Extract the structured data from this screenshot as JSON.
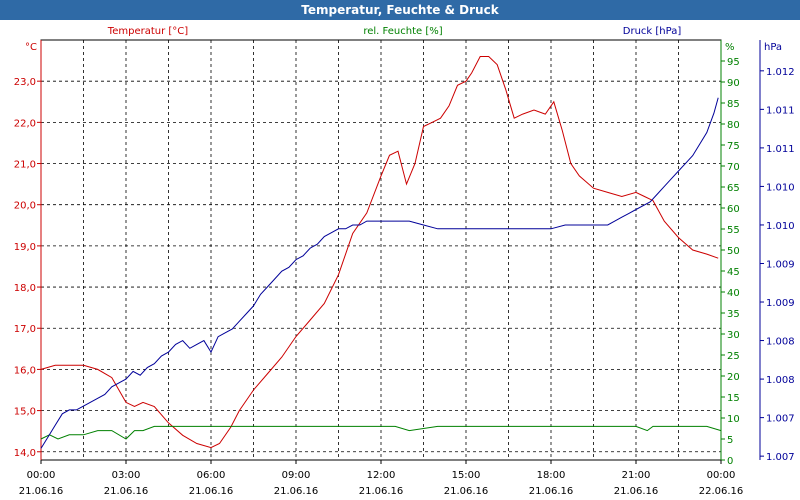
{
  "window": {
    "title": "Temperatur, Feuchte & Druck"
  },
  "colors": {
    "temperature": "#cc0000",
    "humidity": "#008000",
    "pressure": "#000099",
    "titlebar": "#2f6aa6"
  },
  "chart_data": {
    "type": "line",
    "grid": true,
    "x": {
      "tick_times": [
        "00:00",
        "03:00",
        "06:00",
        "09:00",
        "12:00",
        "15:00",
        "18:00",
        "21:00",
        "00:00"
      ],
      "tick_dates": [
        "21.06.16",
        "21.06.16",
        "21.06.16",
        "21.06.16",
        "21.06.16",
        "21.06.16",
        "21.06.16",
        "21.06.16",
        "22.06.16"
      ],
      "range_hours": [
        0,
        24
      ]
    },
    "axes": {
      "temperature": {
        "unit": "°C",
        "ylim": [
          13.8,
          24.0
        ],
        "ticks": [
          "14,0",
          "15,0",
          "16,0",
          "17,0",
          "18,0",
          "19,0",
          "20,0",
          "21,0",
          "22,0",
          "23,0"
        ]
      },
      "humidity": {
        "unit": "%",
        "ylim": [
          0,
          100
        ],
        "ticks": [
          "0",
          "5",
          "10",
          "15",
          "20",
          "25",
          "30",
          "35",
          "40",
          "45",
          "50",
          "55",
          "60",
          "65",
          "70",
          "75",
          "80",
          "85",
          "90",
          "95"
        ]
      },
      "pressure": {
        "unit": "hPa",
        "ylim": [
          1006.95,
          1012.4
        ],
        "ticks": [
          "1.007",
          "1.007",
          "1.008",
          "1.008",
          "1.009",
          "1.009",
          "1.010",
          "1.010",
          "1.011",
          "1.011",
          "1.012"
        ]
      }
    },
    "series": [
      {
        "name": "Temperatur [°C]",
        "axis": "temperature",
        "x": [
          0,
          0.5,
          1,
          1.5,
          2,
          2.5,
          3,
          3.3,
          3.6,
          4,
          4.5,
          5,
          5.5,
          6,
          6.3,
          6.7,
          7,
          7.5,
          8,
          8.5,
          9,
          9.5,
          10,
          10.5,
          11,
          11.5,
          12,
          12.3,
          12.6,
          12.9,
          13.2,
          13.5,
          13.8,
          14.1,
          14.4,
          14.7,
          15,
          15.2,
          15.5,
          15.8,
          16.1,
          16.4,
          16.7,
          17,
          17.4,
          17.8,
          18.1,
          18.4,
          18.7,
          19,
          19.5,
          20,
          20.5,
          21,
          21.3,
          21.6,
          22,
          22.5,
          23,
          23.5,
          23.9
        ],
        "values": [
          16.0,
          16.1,
          16.1,
          16.1,
          16.0,
          15.8,
          15.2,
          15.1,
          15.2,
          15.1,
          14.7,
          14.4,
          14.2,
          14.1,
          14.2,
          14.6,
          15.0,
          15.5,
          15.9,
          16.3,
          16.8,
          17.2,
          17.6,
          18.3,
          19.3,
          19.8,
          20.7,
          21.2,
          21.3,
          20.5,
          21.0,
          21.9,
          22.0,
          22.1,
          22.4,
          22.9,
          23.0,
          23.2,
          23.6,
          23.6,
          23.4,
          22.8,
          22.1,
          22.2,
          22.3,
          22.2,
          22.5,
          21.8,
          21.0,
          20.7,
          20.4,
          20.3,
          20.2,
          20.3,
          20.2,
          20.1,
          19.6,
          19.2,
          18.9,
          18.8,
          18.7
        ]
      },
      {
        "name": "rel. Feuchte [%]",
        "axis": "humidity",
        "x": [
          0,
          0.3,
          0.6,
          1,
          1.5,
          2,
          2.5,
          3,
          3.3,
          3.6,
          4,
          5,
          6,
          8,
          10,
          12,
          12.5,
          13,
          14,
          15,
          16,
          17,
          18,
          19,
          20,
          21,
          21.4,
          21.6,
          22,
          23,
          23.5,
          24
        ],
        "values": [
          5,
          6,
          5,
          6,
          6,
          7,
          7,
          5,
          7,
          7,
          8,
          8,
          8,
          8,
          8,
          8,
          8,
          7,
          8,
          8,
          8,
          8,
          8,
          8,
          8,
          8,
          7,
          8,
          8,
          8,
          8,
          7
        ]
      },
      {
        "name": "Druck [hPa]",
        "axis": "pressure",
        "x": [
          0,
          0.25,
          0.5,
          0.75,
          1,
          1.25,
          1.5,
          1.75,
          2,
          2.25,
          2.5,
          2.75,
          3,
          3.25,
          3.5,
          3.75,
          4,
          4.25,
          4.5,
          4.75,
          5,
          5.25,
          5.5,
          5.75,
          6,
          6.25,
          6.5,
          6.75,
          7,
          7.25,
          7.5,
          7.75,
          8,
          8.25,
          8.5,
          8.75,
          9,
          9.25,
          9.5,
          9.75,
          10,
          10.25,
          10.5,
          10.75,
          11,
          11.25,
          11.5,
          11.75,
          12,
          12.5,
          13,
          13.5,
          14,
          14.5,
          15,
          15.5,
          16,
          16.5,
          17,
          17.5,
          18,
          18.5,
          19,
          19.5,
          20,
          20.25,
          20.5,
          20.75,
          21,
          21.25,
          21.5,
          21.75,
          22,
          22.25,
          22.5,
          22.75,
          23,
          23.25,
          23.5,
          23.75,
          23.9
        ],
        "values": [
          1007.1,
          1007.25,
          1007.4,
          1007.55,
          1007.6,
          1007.6,
          1007.65,
          1007.7,
          1007.75,
          1007.8,
          1007.9,
          1007.95,
          1008.0,
          1008.1,
          1008.05,
          1008.15,
          1008.2,
          1008.3,
          1008.35,
          1008.45,
          1008.5,
          1008.4,
          1008.45,
          1008.5,
          1008.35,
          1008.55,
          1008.6,
          1008.65,
          1008.75,
          1008.85,
          1008.95,
          1009.1,
          1009.2,
          1009.3,
          1009.4,
          1009.45,
          1009.55,
          1009.6,
          1009.7,
          1009.75,
          1009.85,
          1009.9,
          1009.95,
          1009.95,
          1010.0,
          1010.0,
          1010.05,
          1010.05,
          1010.05,
          1010.05,
          1010.05,
          1010.0,
          1009.95,
          1009.95,
          1009.95,
          1009.95,
          1009.95,
          1009.95,
          1009.95,
          1009.95,
          1009.95,
          1010.0,
          1010.0,
          1010.0,
          1010.0,
          1010.05,
          1010.1,
          1010.15,
          1010.2,
          1010.25,
          1010.3,
          1010.4,
          1010.5,
          1010.6,
          1010.7,
          1010.8,
          1010.9,
          1011.05,
          1011.2,
          1011.45,
          1011.65
        ]
      }
    ]
  }
}
